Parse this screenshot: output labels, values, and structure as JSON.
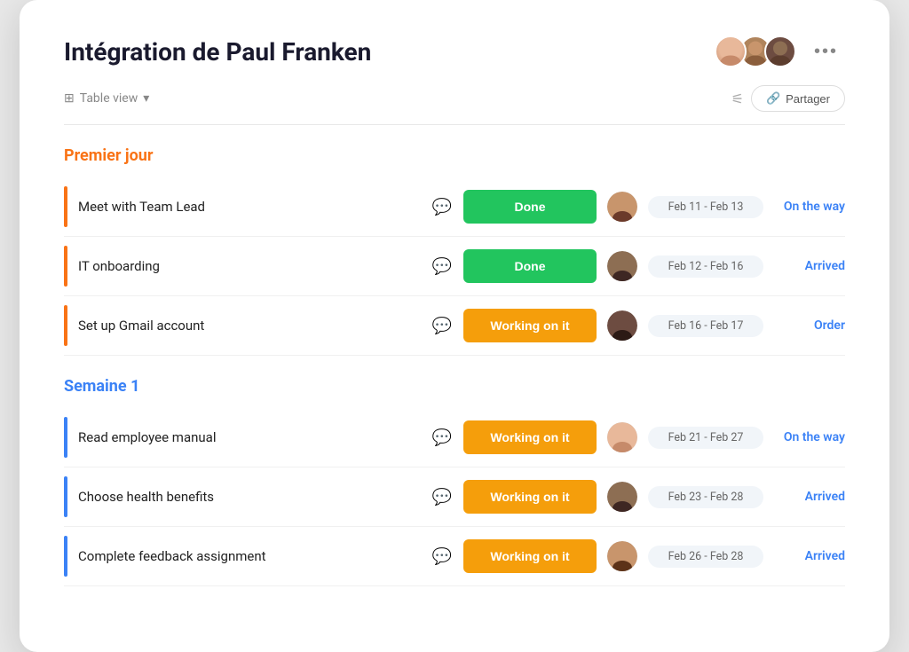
{
  "page": {
    "title": "Intégration de Paul Franken"
  },
  "toolbar": {
    "view_label": "Table view",
    "share_label": "Partager"
  },
  "sections": [
    {
      "id": "premier-jour",
      "title": "Premier jour",
      "color": "orange",
      "rows": [
        {
          "id": "row-1",
          "task": "Meet with Team Lead",
          "status": "Done",
          "status_type": "done",
          "date": "Feb 11 - Feb 13",
          "link": "On the way",
          "link_color": "blue",
          "comment_active": false,
          "face": "face-1",
          "indicator": "orange"
        },
        {
          "id": "row-2",
          "task": "IT onboarding",
          "status": "Done",
          "status_type": "done",
          "date": "Feb 12 - Feb 16",
          "link": "Arrived",
          "link_color": "blue",
          "comment_active": false,
          "face": "face-2",
          "indicator": "orange"
        },
        {
          "id": "row-3",
          "task": "Set up Gmail account",
          "status": "Working on it",
          "status_type": "working",
          "date": "Feb 16 - Feb 17",
          "link": "Order",
          "link_color": "blue",
          "comment_active": false,
          "face": "face-3",
          "indicator": "orange"
        }
      ]
    },
    {
      "id": "semaine-1",
      "title": "Semaine 1",
      "color": "blue",
      "rows": [
        {
          "id": "row-4",
          "task": "Read employee manual",
          "status": "Working on it",
          "status_type": "working",
          "date": "Feb 21 - Feb 27",
          "link": "On the way",
          "link_color": "blue",
          "comment_active": false,
          "face": "face-4",
          "indicator": "blue"
        },
        {
          "id": "row-5",
          "task": "Choose health benefits",
          "status": "Working on it",
          "status_type": "working",
          "date": "Feb 23 - Feb 28",
          "link": "Arrived",
          "link_color": "blue",
          "comment_active": true,
          "face": "face-5",
          "indicator": "blue"
        },
        {
          "id": "row-6",
          "task": "Complete feedback assignment",
          "status": "Working on it",
          "status_type": "working",
          "date": "Feb 26 - Feb 28",
          "link": "Arrived",
          "link_color": "blue",
          "comment_active": false,
          "face": "face-6",
          "indicator": "blue"
        }
      ]
    }
  ],
  "icons": {
    "table_view": "⊞",
    "chevron": "▾",
    "filter": "⚟",
    "link": "🔗",
    "dots": "•••",
    "comment": "💬"
  }
}
